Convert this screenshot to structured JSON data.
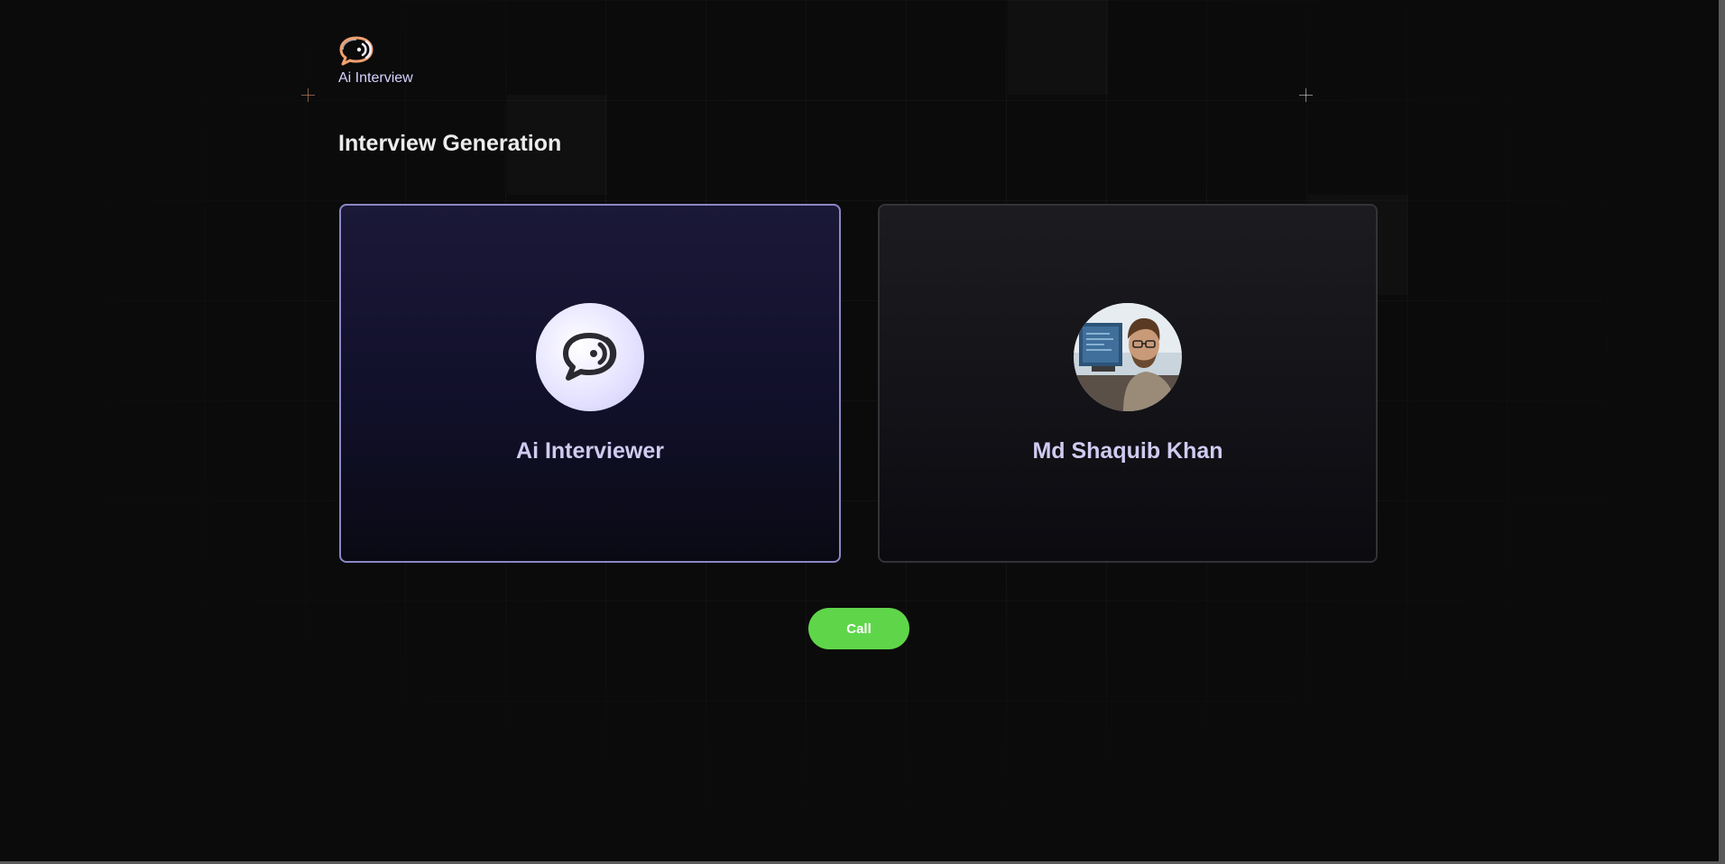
{
  "app": {
    "logo_icon": "chat-speaker-icon",
    "logo_text": "Ai Interview"
  },
  "page": {
    "title": "Interview Generation"
  },
  "cards": {
    "ai": {
      "name": "Ai Interviewer",
      "icon": "chat-speaker-icon"
    },
    "user": {
      "name": "Md Shaquib Khan",
      "avatar": "user-photo"
    }
  },
  "actions": {
    "call_label": "Call"
  },
  "colors": {
    "accent_purple": "#8b87c4",
    "call_green": "#5fd64a",
    "logo_orange": "#f0a070",
    "text_light": "#cfcbf0"
  }
}
